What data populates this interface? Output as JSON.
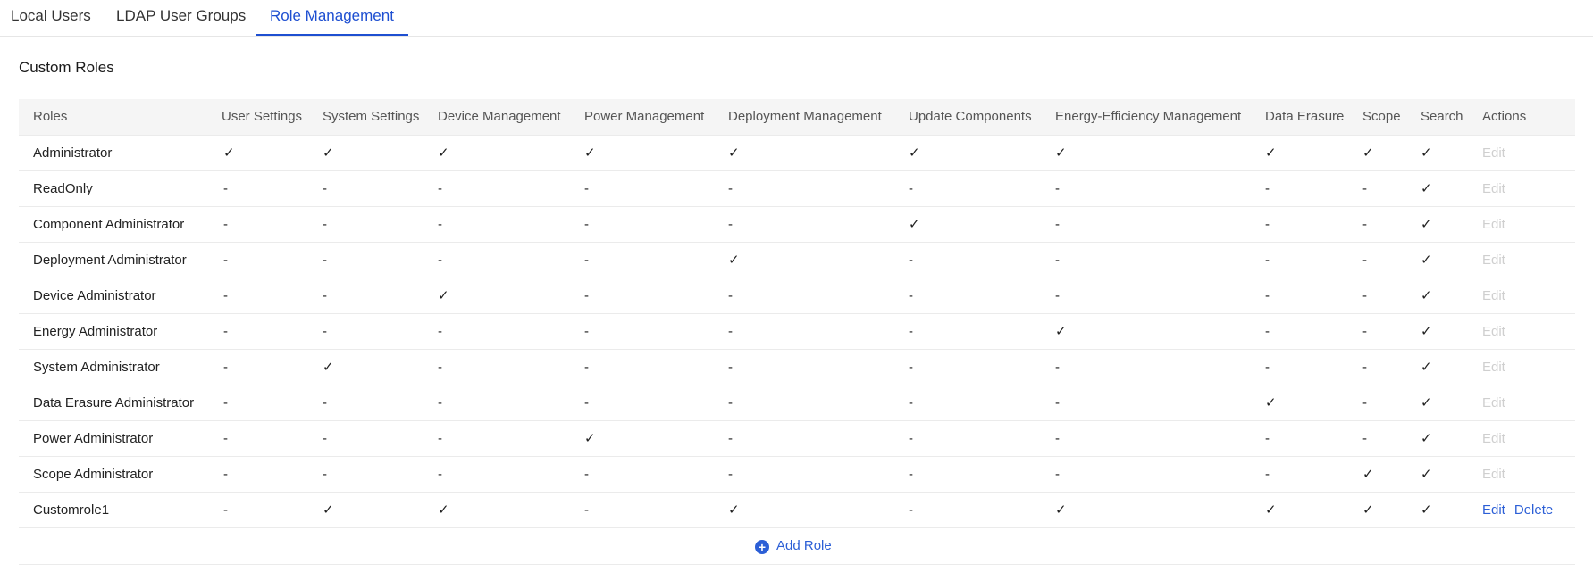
{
  "tabs": [
    {
      "label": "Local Users",
      "active": false
    },
    {
      "label": "LDAP User Groups",
      "active": false
    },
    {
      "label": "Role Management",
      "active": true
    }
  ],
  "section_title": "Custom Roles",
  "columns": [
    "Roles",
    "User Settings",
    "System Settings",
    "Device Management",
    "Power Management",
    "Deployment Management",
    "Update Components",
    "Energy-Efficiency Management",
    "Data Erasure",
    "Scope",
    "Search",
    "Actions"
  ],
  "rows": [
    {
      "role": "Administrator",
      "marks": [
        "✓",
        "✓",
        "✓",
        "✓",
        "✓",
        "✓",
        "✓",
        "✓",
        "✓",
        "✓"
      ],
      "edit": "Edit",
      "edit_enabled": false,
      "delete": ""
    },
    {
      "role": "ReadOnly",
      "marks": [
        "-",
        "-",
        "-",
        "-",
        "-",
        "-",
        "-",
        "-",
        "-",
        "✓"
      ],
      "edit": "Edit",
      "edit_enabled": false,
      "delete": ""
    },
    {
      "role": "Component Administrator",
      "marks": [
        "-",
        "-",
        "-",
        "-",
        "-",
        "✓",
        "-",
        "-",
        "-",
        "✓"
      ],
      "edit": "Edit",
      "edit_enabled": false,
      "delete": ""
    },
    {
      "role": "Deployment Administrator",
      "marks": [
        "-",
        "-",
        "-",
        "-",
        "✓",
        "-",
        "-",
        "-",
        "-",
        "✓"
      ],
      "edit": "Edit",
      "edit_enabled": false,
      "delete": ""
    },
    {
      "role": "Device Administrator",
      "marks": [
        "-",
        "-",
        "✓",
        "-",
        "-",
        "-",
        "-",
        "-",
        "-",
        "✓"
      ],
      "edit": "Edit",
      "edit_enabled": false,
      "delete": ""
    },
    {
      "role": "Energy Administrator",
      "marks": [
        "-",
        "-",
        "-",
        "-",
        "-",
        "-",
        "✓",
        "-",
        "-",
        "✓"
      ],
      "edit": "Edit",
      "edit_enabled": false,
      "delete": ""
    },
    {
      "role": "System Administrator",
      "marks": [
        "-",
        "✓",
        "-",
        "-",
        "-",
        "-",
        "-",
        "-",
        "-",
        "✓"
      ],
      "edit": "Edit",
      "edit_enabled": false,
      "delete": ""
    },
    {
      "role": "Data Erasure Administrator",
      "marks": [
        "-",
        "-",
        "-",
        "-",
        "-",
        "-",
        "-",
        "✓",
        "-",
        "✓"
      ],
      "edit": "Edit",
      "edit_enabled": false,
      "delete": ""
    },
    {
      "role": "Power Administrator",
      "marks": [
        "-",
        "-",
        "-",
        "✓",
        "-",
        "-",
        "-",
        "-",
        "-",
        "✓"
      ],
      "edit": "Edit",
      "edit_enabled": false,
      "delete": ""
    },
    {
      "role": "Scope Administrator",
      "marks": [
        "-",
        "-",
        "-",
        "-",
        "-",
        "-",
        "-",
        "-",
        "✓",
        "✓"
      ],
      "edit": "Edit",
      "edit_enabled": false,
      "delete": ""
    },
    {
      "role": "Customrole1",
      "marks": [
        "-",
        "✓",
        "✓",
        "-",
        "✓",
        "-",
        "✓",
        "✓",
        "✓",
        "✓"
      ],
      "edit": "Edit",
      "edit_enabled": true,
      "delete": "Delete"
    }
  ],
  "add_role_label": "Add Role",
  "colors": {
    "accent": "#1e4fd1",
    "link": "#2c5fd6",
    "disabled": "#cfcfcf",
    "header_bg": "#f5f5f5"
  }
}
